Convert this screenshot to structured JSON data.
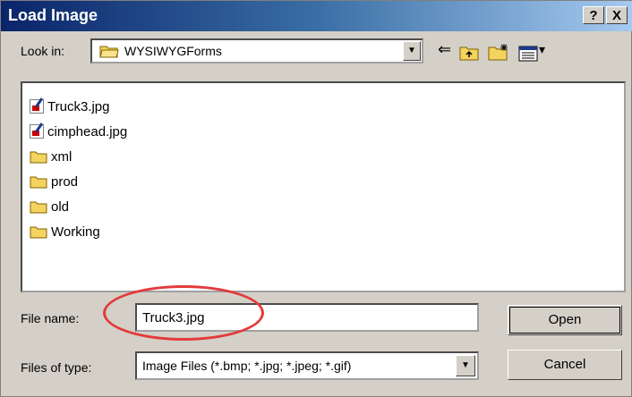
{
  "window": {
    "title": "Load Image",
    "help_label": "?",
    "close_label": "X"
  },
  "lookin": {
    "label": "Look in:",
    "folder": "WYSIWYGForms",
    "arrow": "▼",
    "icons": [
      "back-icon",
      "up-folder-icon",
      "new-folder-icon",
      "view-menu-icon"
    ],
    "back_glyph": "⇐",
    "view_glyph": "▾"
  },
  "files": [
    {
      "name": "Truck3.jpg",
      "type": "image"
    },
    {
      "name": "cimphead.jpg",
      "type": "image"
    },
    {
      "name": "xml",
      "type": "folder"
    },
    {
      "name": "prod",
      "type": "folder"
    },
    {
      "name": "old",
      "type": "folder"
    },
    {
      "name": "Working",
      "type": "folder"
    }
  ],
  "filename": {
    "label": "File name:",
    "value": "Truck3.jpg"
  },
  "filetype": {
    "label": "Files of type:",
    "value": "Image Files (*.bmp; *.jpg; *.jpeg; *.gif)",
    "arrow": "▼"
  },
  "buttons": {
    "open": "Open",
    "cancel": "Cancel"
  },
  "colors": {
    "highlight_circle": "#e33a3a",
    "title_start": "#0a246a",
    "title_end": "#a6caf0"
  }
}
